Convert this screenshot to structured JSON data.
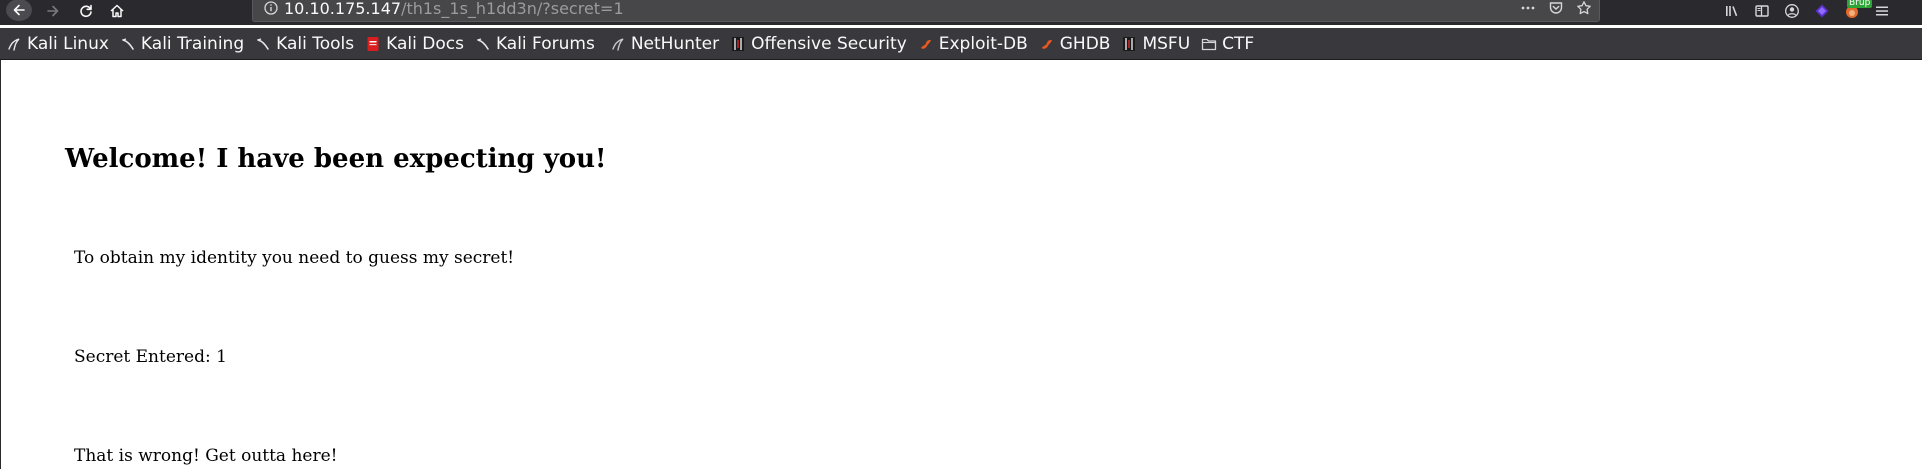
{
  "browser": {
    "url_host": "10.10.175.147",
    "url_path": "/th1s_1s_h1dd3n/?secret=1",
    "burp_badge": "Brup"
  },
  "bookmarks": [
    {
      "label": "Kali Linux",
      "icon": "kali-dragon-icon"
    },
    {
      "label": "Kali Training",
      "icon": "kali-dragon-icon"
    },
    {
      "label": "Kali Tools",
      "icon": "kali-dragon-icon"
    },
    {
      "label": "Kali Docs",
      "icon": "kali-docs-icon"
    },
    {
      "label": "Kali Forums",
      "icon": "kali-dragon-icon"
    },
    {
      "label": "NetHunter",
      "icon": "nethunter-icon"
    },
    {
      "label": "Offensive Security",
      "icon": "offsec-icon"
    },
    {
      "label": "Exploit-DB",
      "icon": "exploitdb-icon"
    },
    {
      "label": "GHDB",
      "icon": "exploitdb-icon"
    },
    {
      "label": "MSFU",
      "icon": "offsec-icon"
    },
    {
      "label": "CTF",
      "icon": "folder-icon"
    }
  ],
  "page": {
    "heading": "Welcome! I have been expecting you!",
    "line1": "To obtain my identity you need to guess my secret!",
    "line2": "Secret Entered: 1",
    "line3": "That is wrong! Get outta here!"
  },
  "colors": {
    "chrome_bg": "#2a2a2e",
    "bookmarks_bg": "#38383d",
    "urlbar_bg": "#474749",
    "exploitdb_orange": "#e9581f",
    "kali_docs_red": "#d81e1e",
    "burp_green": "#2ea336"
  }
}
